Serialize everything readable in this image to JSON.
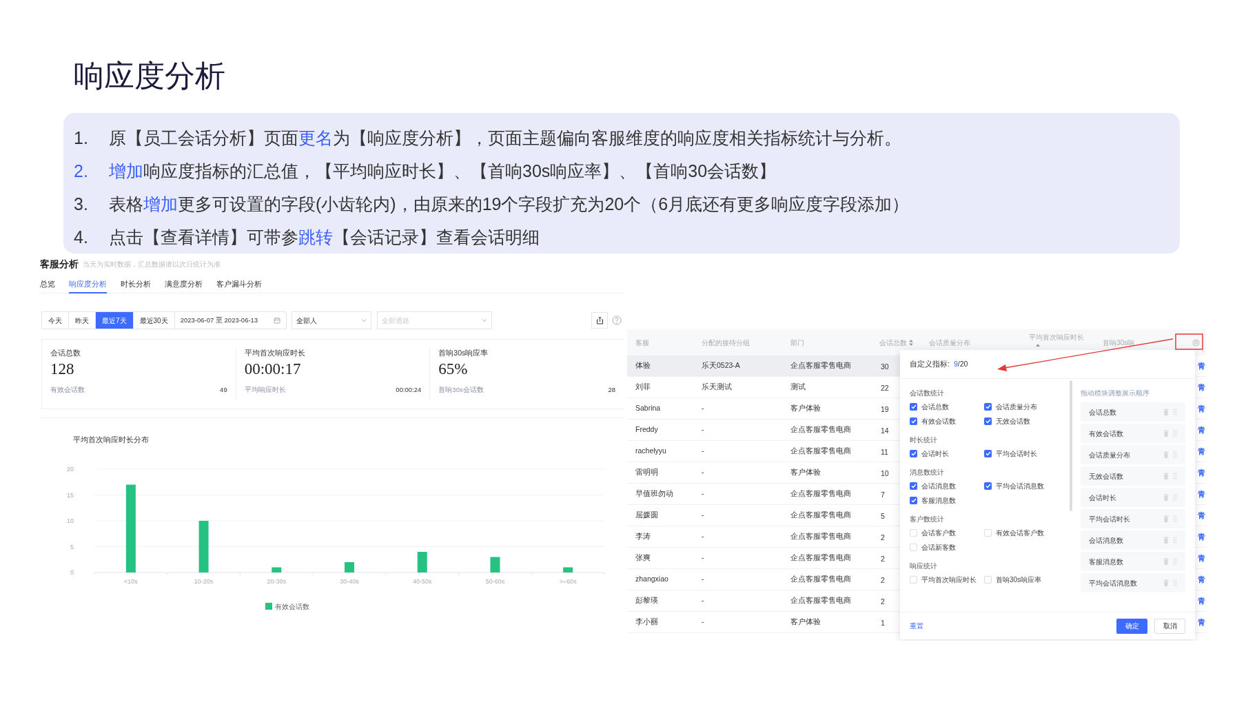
{
  "slide_title": "响应度分析",
  "notes": [
    {
      "number": "1.",
      "number_accent": false,
      "segments": [
        {
          "text": "原【员工会话分析】页面",
          "accent": false
        },
        {
          "text": "更名",
          "accent": true
        },
        {
          "text": "为【响应度分析】，页面主题偏向客服维度的响应度相关指标统计与分析。",
          "accent": false
        }
      ]
    },
    {
      "number": "2.",
      "number_accent": true,
      "segments": [
        {
          "text": "增加",
          "accent": true
        },
        {
          "text": "响应度指标的汇总值，【平均响应时长】、【首响30s响应率】、【首响30会话数】",
          "accent": false
        }
      ]
    },
    {
      "number": "3.",
      "number_accent": false,
      "segments": [
        {
          "text": "表格",
          "accent": false
        },
        {
          "text": "增加",
          "accent": true
        },
        {
          "text": "更多可设置的字段(小齿轮内)，由原来的19个字段扩充为20个（6月底还有更多响应度字段添加）",
          "accent": false
        }
      ]
    },
    {
      "number": "4.",
      "number_accent": false,
      "segments": [
        {
          "text": "点击【查看详情】可带参",
          "accent": false
        },
        {
          "text": "跳转",
          "accent": true
        },
        {
          "text": "【会话记录】查看会话明细",
          "accent": false
        }
      ]
    }
  ],
  "app": {
    "title": "客服分析",
    "subtitle": "当天为实时数据，汇总数据请以次日统计为准",
    "tabs": [
      {
        "label": "总览",
        "selected": false
      },
      {
        "label": "响应度分析",
        "selected": true
      },
      {
        "label": "时长分析",
        "selected": false
      },
      {
        "label": "满意度分析",
        "selected": false
      },
      {
        "label": "客户漏斗分析",
        "selected": false
      }
    ],
    "quick_ranges": [
      {
        "label": "今天",
        "selected": false
      },
      {
        "label": "昨天",
        "selected": false
      },
      {
        "label": "最近7天",
        "selected": true
      },
      {
        "label": "最近30天",
        "selected": false
      }
    ],
    "date_range": "2023-06-07 至 2023-06-13",
    "agent_select": "全部人",
    "channel_select": {
      "placeholder": "全部通路"
    },
    "stats": [
      {
        "label": "会话总数",
        "value": "128",
        "sub_label": "有效会话数",
        "sub_value": "49"
      },
      {
        "label": "平均首次响应时长",
        "value": "00:00:17",
        "sub_label": "平均响应时长",
        "sub_value": "00:00:24"
      },
      {
        "label": "首响30s响应率",
        "value": "65%",
        "sub_label": "首响30s会话数",
        "sub_value": "28"
      }
    ],
    "chart": {
      "chart_data": {
        "type": "bar",
        "grid": true,
        "title": "平均首次响应时长分布",
        "categories": [
          "<10s",
          "10-20s",
          "20-30s",
          "30-40s",
          "40-50s",
          "50-60s",
          ">=60s"
        ],
        "ylim": [
          0,
          20
        ],
        "yticks": [
          0,
          5,
          10,
          15,
          20
        ],
        "series": [
          {
            "name": "有效会话数",
            "color": "#26c281",
            "values": [
              17,
              10,
              1,
              2,
              4,
              3,
              1
            ]
          }
        ]
      }
    }
  },
  "table": {
    "columns": [
      "客服",
      "分配的接待分组",
      "部门",
      "会话总数",
      "会话质量分布",
      "平均首次响应时长",
      "首响30s响"
    ],
    "rows": [
      {
        "agent": "体验",
        "group": "乐天0523-A",
        "department": "企点客服零售电商",
        "sessions": "30",
        "column_8": "青",
        "selected": true
      },
      {
        "agent": "刘菲",
        "group": "乐天测试",
        "department": "测试",
        "sessions": "22",
        "column_8": "青",
        "selected": false
      },
      {
        "agent": "Sabrina",
        "group": "-",
        "department": "客户体验",
        "sessions": "19",
        "column_8": "青",
        "selected": false
      },
      {
        "agent": "Freddy",
        "group": "-",
        "department": "企点客服零售电商",
        "sessions": "14",
        "column_8": "青",
        "selected": false
      },
      {
        "agent": "rachelyyu",
        "group": "-",
        "department": "企点客服零售电商",
        "sessions": "11",
        "column_8": "青",
        "selected": false
      },
      {
        "agent": "雷明明",
        "group": "-",
        "department": "客户体验",
        "sessions": "10",
        "column_8": "青",
        "selected": false
      },
      {
        "agent": "早值班勿动",
        "group": "-",
        "department": "企点客服零售电商",
        "sessions": "7",
        "column_8": "青",
        "selected": false
      },
      {
        "agent": "屈媛圆",
        "group": "-",
        "department": "企点客服零售电商",
        "sessions": "5",
        "column_8": "青",
        "selected": false
      },
      {
        "agent": "李涛",
        "group": "-",
        "department": "企点客服零售电商",
        "sessions": "2",
        "column_8": "青",
        "selected": false
      },
      {
        "agent": "张爽",
        "group": "-",
        "department": "企点客服零售电商",
        "sessions": "2",
        "column_8": "青",
        "selected": false
      },
      {
        "agent": "zhangxiao",
        "group": "-",
        "department": "企点客服零售电商",
        "sessions": "2",
        "column_8": "青",
        "selected": false
      },
      {
        "agent": "彭黎瑛",
        "group": "-",
        "department": "企点客服零售电商",
        "sessions": "2",
        "column_8": "青",
        "selected": false
      },
      {
        "agent": "李小丽",
        "group": "-",
        "department": "客户体验",
        "sessions": "1",
        "column_8": "青",
        "selected": false
      }
    ]
  },
  "settings_panel": {
    "title": "自定义指标:",
    "count": "9",
    "total": "/20",
    "groups": [
      {
        "title": "会话数统计",
        "options": [
          {
            "label": "会话总数",
            "checked": true
          },
          {
            "label": "会话质量分布",
            "checked": true
          },
          {
            "label": "有效会话数",
            "checked": true
          },
          {
            "label": "无效会话数",
            "checked": true
          }
        ]
      },
      {
        "title": "时长统计",
        "options": [
          {
            "label": "会话时长",
            "checked": true
          },
          {
            "label": "平均会话时长",
            "checked": true
          }
        ]
      },
      {
        "title": "消息数统计",
        "options": [
          {
            "label": "会话消息数",
            "checked": true
          },
          {
            "label": "平均会话消息数",
            "checked": true
          },
          {
            "label": "客服消息数",
            "checked": true
          }
        ]
      },
      {
        "title": "客户数统计",
        "options": [
          {
            "label": "会话客户数",
            "checked": false
          },
          {
            "label": "有效会话客户数",
            "checked": false
          },
          {
            "label": "会话新客数",
            "checked": false
          }
        ]
      },
      {
        "title": "响应统计",
        "options": [
          {
            "label": "平均首次响应时长",
            "checked": false
          },
          {
            "label": "首响30s响应率",
            "checked": false
          }
        ]
      }
    ],
    "order_hint": "拖动模块调整展示顺序",
    "order": [
      "会话总数",
      "有效会话数",
      "会话质量分布",
      "无效会话数",
      "会话时长",
      "平均会话时长",
      "会话消息数",
      "客服消息数",
      "平均会话消息数"
    ],
    "buttons": {
      "reset": "重置",
      "confirm": "确定",
      "cancel": "取消"
    }
  }
}
